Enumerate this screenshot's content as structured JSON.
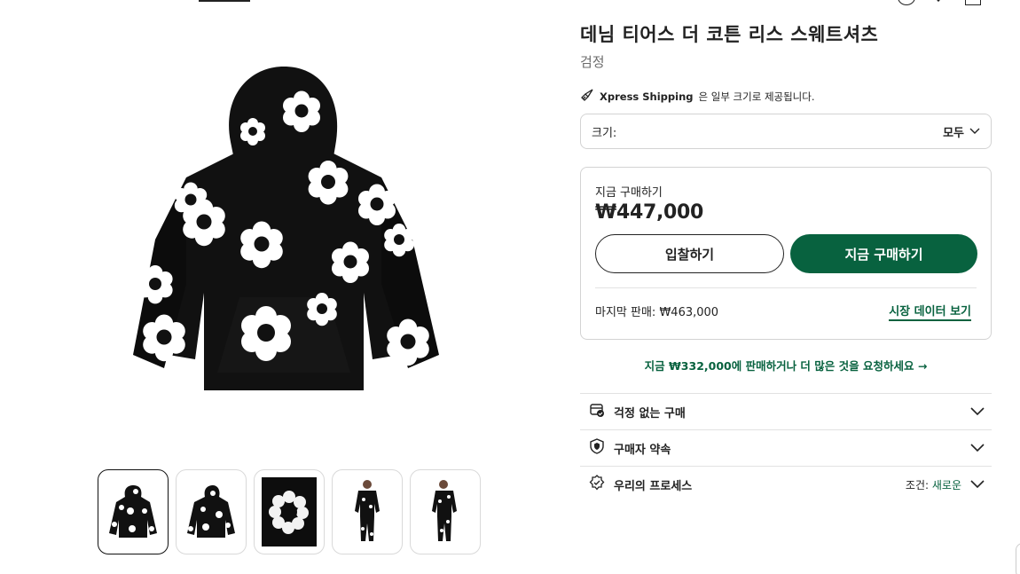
{
  "product": {
    "title": "데님 티어스 더 코튼 리스 스웨트셔츠",
    "color": "검정"
  },
  "shipping": {
    "brand": "Xpress Shipping",
    "text": "은 일부 크기로 제공됩니다."
  },
  "size": {
    "label": "크기:",
    "value": "모두"
  },
  "buy": {
    "label": "지금 구매하기",
    "price": "₩447,000",
    "bid_button": "입찰하기",
    "buy_button": "지금 구매하기",
    "last_sale": "마지막 판매: ₩463,000",
    "market_link": "시장 데이터 보기"
  },
  "sell_link": "지금 ₩332,000에 판매하거나 더 많은 것을 요청하세요 →",
  "accordion": [
    {
      "label": "걱정 없는 구매",
      "icon": "receipt-check-icon"
    },
    {
      "label": "구매자 약속",
      "icon": "shield-icon"
    },
    {
      "label": "우리의 프로세스",
      "icon": "verified-badge-icon",
      "condition_label": "조건:",
      "condition_value": "새로운"
    }
  ],
  "thumbnails": [
    "hoodie-front",
    "hoodie-back",
    "wreath-detail",
    "model-front",
    "model-side"
  ],
  "colors": {
    "accent": "#08623f",
    "text": "#222222",
    "border": "#d3d3d3"
  }
}
